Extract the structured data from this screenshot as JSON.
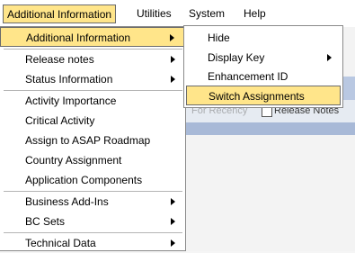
{
  "menubar": {
    "items": [
      "Additional Information",
      "Utilities",
      "System",
      "Help"
    ]
  },
  "background": {
    "faded_label": "For Recency",
    "release_notes": "Release Notes"
  },
  "menu_additional": {
    "items": [
      "Additional Information",
      "Release notes",
      "Status Information",
      "Activity Importance",
      "Critical Activity",
      "Assign to ASAP Roadmap",
      "Country Assignment",
      "Application Components",
      "Business Add-Ins",
      "BC Sets",
      "Technical Data"
    ]
  },
  "submenu": {
    "items": [
      "Hide",
      "Display Key",
      "Enhancement ID",
      "Switch Assignments"
    ]
  },
  "icons": {
    "submenu_arrow": "triangle-right",
    "release_notes_icon": "document-icon"
  }
}
